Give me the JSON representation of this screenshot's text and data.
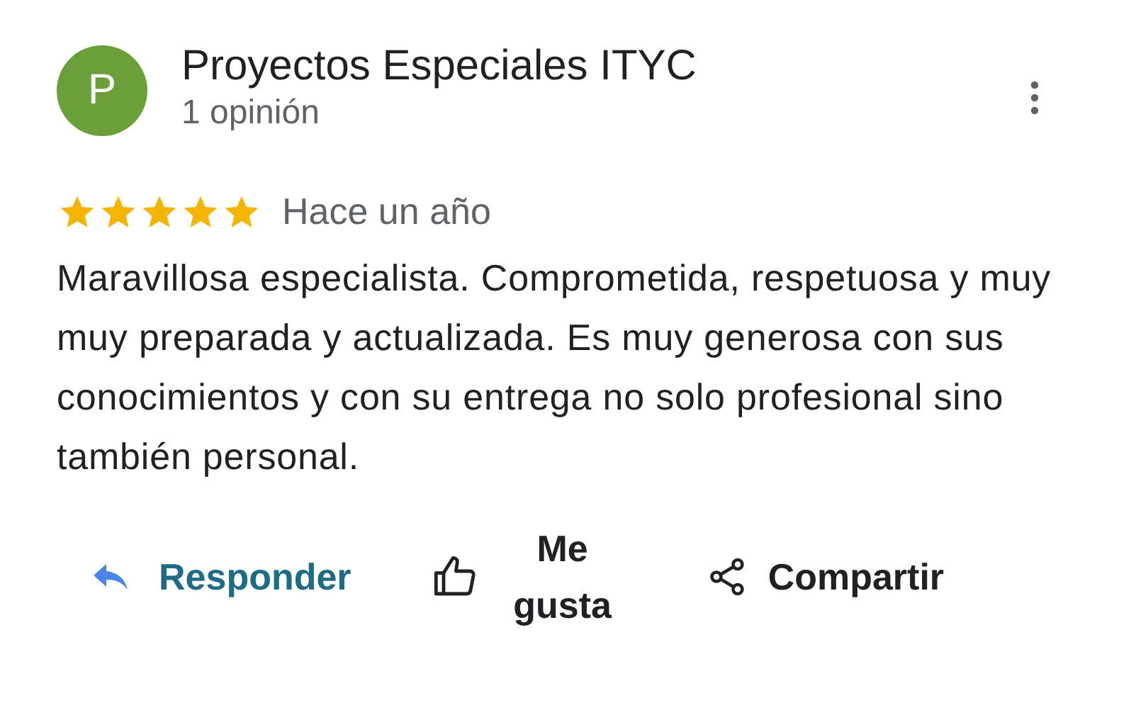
{
  "review": {
    "avatar_letter": "P",
    "author": "Proyectos Especiales ITYC",
    "count": "1 opinión",
    "stars": 5,
    "time": "Hace un año",
    "text": "Maravillosa especialista. Comprometida, respetuosa y muy muy preparada y actualizada.  Es muy generosa con sus conocimientos y con su entrega no solo profesional sino también personal."
  },
  "actions": [
    {
      "kind": "reply",
      "label": "Responder"
    },
    {
      "kind": "like",
      "label": "Me gusta"
    },
    {
      "kind": "share",
      "label": "Compartir"
    }
  ]
}
